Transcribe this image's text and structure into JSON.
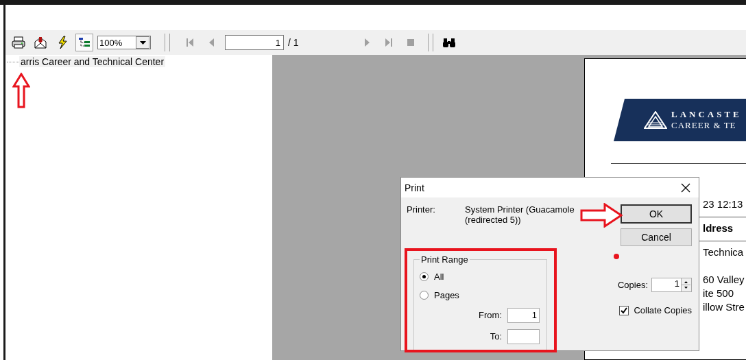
{
  "toolbar": {
    "zoom": "100%",
    "tree_toggle_on": true,
    "page": "1",
    "page_total": "/ 1",
    "nav_buttons": [
      {
        "kind": "first",
        "disabled": true
      },
      {
        "kind": "prev",
        "disabled": true
      },
      {
        "kind": "next",
        "disabled": true
      },
      {
        "kind": "last",
        "disabled": true
      },
      {
        "kind": "stop",
        "disabled": true
      }
    ]
  },
  "tree": {
    "items": [
      {
        "label": "arris Career and Technical Center"
      }
    ]
  },
  "report": {
    "logo_lines": [
      "LANCASTE",
      "CAREER & TE"
    ],
    "lines": [
      {
        "kind": "plain",
        "text": "23  12:13"
      },
      {
        "kind": "rule"
      },
      {
        "kind": "heading",
        "text": "ldress"
      },
      {
        "kind": "rule"
      },
      {
        "kind": "plain",
        "text": "Technica"
      },
      {
        "kind": "gap"
      },
      {
        "kind": "plain",
        "text": "60 Valley"
      },
      {
        "kind": "plain",
        "text": "ite 500"
      },
      {
        "kind": "plain",
        "text": "illow Stre"
      }
    ]
  },
  "dialog": {
    "title": "Print",
    "printer_label": "Printer:",
    "printer_lines": [
      "System Printer (Guacamole",
      "(redirected 5))"
    ],
    "buttons": [
      "OK",
      "Cancel"
    ],
    "range": {
      "title": "Print Range",
      "options": [
        {
          "label": "All",
          "selected": true
        },
        {
          "label": "Pages",
          "selected": false
        }
      ],
      "from_label": "From:",
      "from_value": "1",
      "to_label": "To:"
    },
    "copies_label": "Copies:",
    "copies_value": "1",
    "collate": {
      "label": "Collate Copies",
      "checked": true
    }
  }
}
